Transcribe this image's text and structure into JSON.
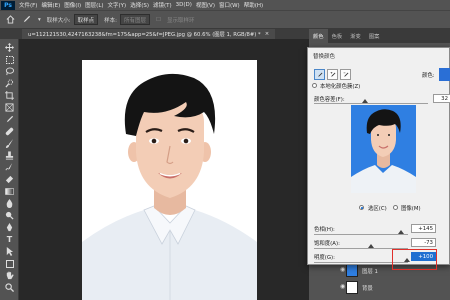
{
  "menu": {
    "logo": "Ps",
    "items": [
      "文件(F)",
      "编辑(E)",
      "图像(I)",
      "图层(L)",
      "文字(Y)",
      "选择(S)",
      "滤镜(T)",
      "3D(D)",
      "视图(V)",
      "窗口(W)",
      "帮助(H)"
    ]
  },
  "options_bar": {
    "sample_size_label": "取样大小:",
    "sample_size_value": "取样点",
    "sample_label": "样本:",
    "sample_value": "所有图层",
    "show_ring_label": "显示取样环"
  },
  "document_tab": {
    "title": "u=112121530,4247163238&fm=175&app=25&f=JPEG.jpg @ 60.6% (图层 1, RGB/8#) *",
    "close": "×"
  },
  "panel_tabs": [
    "颜色",
    "色板",
    "渐变",
    "图案"
  ],
  "dialog": {
    "title": "替换颜色",
    "localized_clusters_label": "本地化颜色簇(Z)",
    "color_label": "颜色:",
    "fuzziness_label": "颜色容差(F):",
    "fuzziness_value": "32",
    "selection_label": "选区(C)",
    "image_label": "图像(M)",
    "hue_label": "色相(H):",
    "hue_value": "+145",
    "saturation_label": "饱和度(A):",
    "saturation_value": "-73",
    "lightness_label": "明度(G):",
    "lightness_value": "+100",
    "selected_color": "#2a6fd6",
    "preview_bg": "#2f7fe2",
    "highlight_color": "#e0302b"
  },
  "layers": [
    {
      "name": "图层 1"
    },
    {
      "name": "背景"
    }
  ],
  "icons": {
    "tools": [
      "move-icon",
      "marquee-icon",
      "lasso-icon",
      "quick-select-icon",
      "crop-icon",
      "frame-icon",
      "eyedropper-icon",
      "healing-icon",
      "brush-icon",
      "stamp-icon",
      "history-brush-icon",
      "eraser-icon",
      "gradient-icon",
      "blur-icon",
      "dodge-icon",
      "pen-icon",
      "type-icon",
      "path-select-icon",
      "shape-icon",
      "hand-icon",
      "zoom-icon"
    ]
  }
}
